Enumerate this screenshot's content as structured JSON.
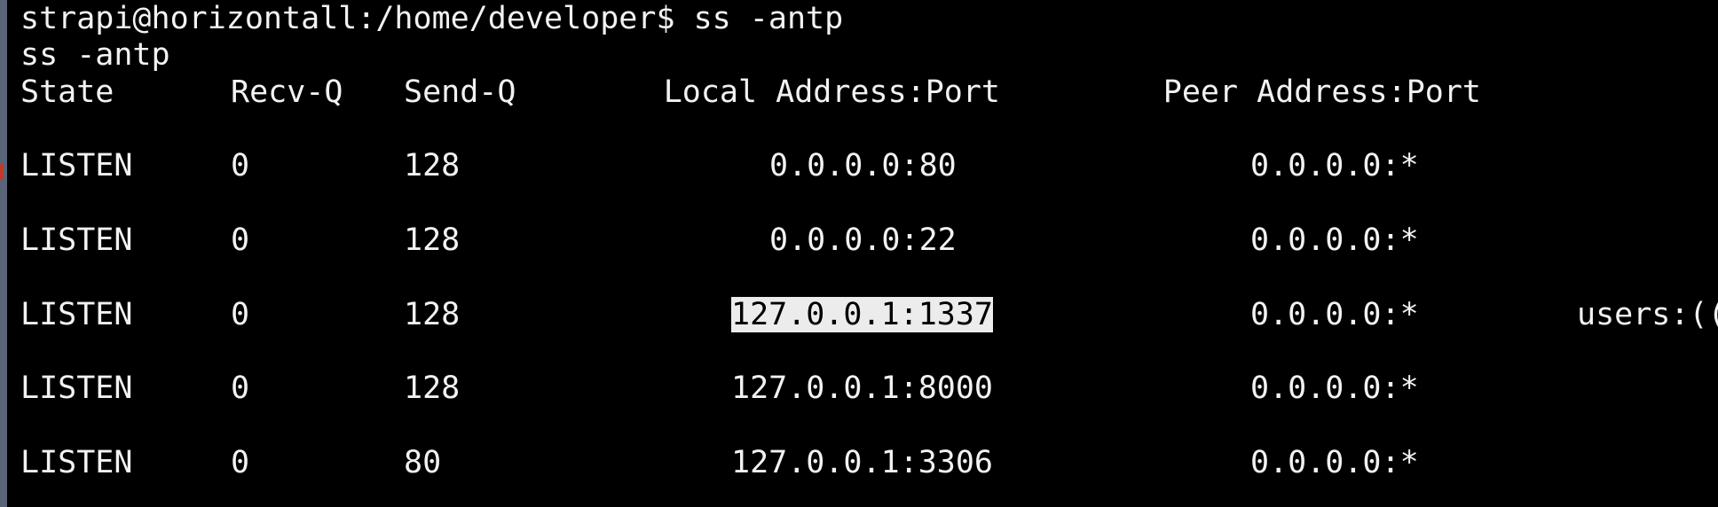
{
  "terminal": {
    "prompt_line": "strapi@horizontall:/home/developer$ ss -antp",
    "echo_line": "ss -antp",
    "headers": {
      "state": "State",
      "recv_q": "Recv-Q",
      "send_q": "Send-Q",
      "local": "Local Address:Port",
      "peer": "Peer Address:Port"
    },
    "rows": [
      {
        "state": "LISTEN",
        "recv_q": "0",
        "send_q": "128",
        "local": "0.0.0.0:80",
        "peer": "0.0.0.0:*",
        "process": ""
      },
      {
        "state": "LISTEN",
        "recv_q": "0",
        "send_q": "128",
        "local": "0.0.0.0:22",
        "peer": "0.0.0.0:*",
        "process": ""
      },
      {
        "state": "LISTEN",
        "recv_q": "0",
        "send_q": "128",
        "local": "127.0.0.1:1337",
        "peer": "0.0.0.0:*",
        "process": "users:(("
      },
      {
        "state": "LISTEN",
        "recv_q": "0",
        "send_q": "128",
        "local": "127.0.0.1:8000",
        "peer": "0.0.0.0:*",
        "process": ""
      },
      {
        "state": "LISTEN",
        "recv_q": "0",
        "send_q": "80",
        "local": "127.0.0.1:3306",
        "peer": "0.0.0.0:*",
        "process": ""
      }
    ],
    "selected_text": "127.0.0.1:1337",
    "colors": {
      "background": "#000000",
      "foreground": "#f2f2f2",
      "selection_bg": "#ececec",
      "selection_fg": "#000000"
    }
  }
}
